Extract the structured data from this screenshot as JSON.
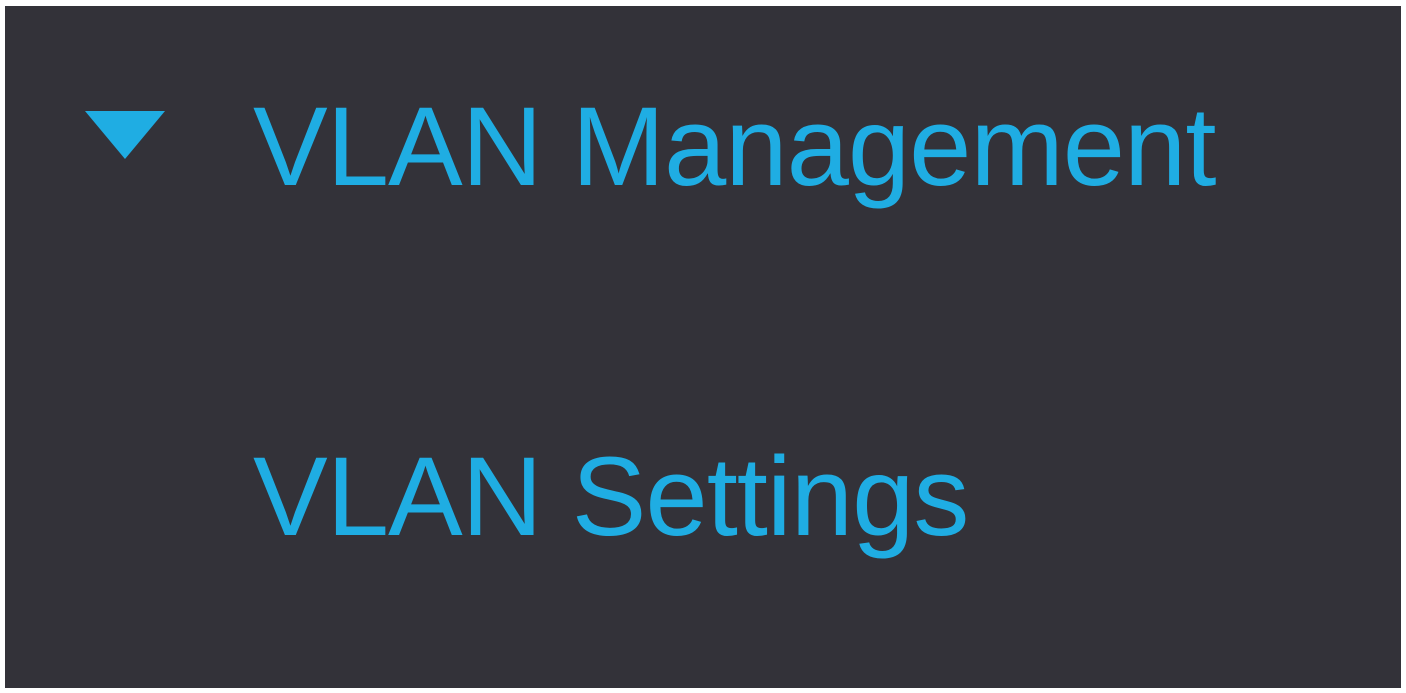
{
  "sidebar": {
    "group": {
      "label": "VLAN Management",
      "expanded": true,
      "icon": "caret-down-icon"
    },
    "items": [
      {
        "label": "VLAN Settings"
      }
    ]
  },
  "colors": {
    "accent": "#1fade3",
    "background": "#333239"
  }
}
